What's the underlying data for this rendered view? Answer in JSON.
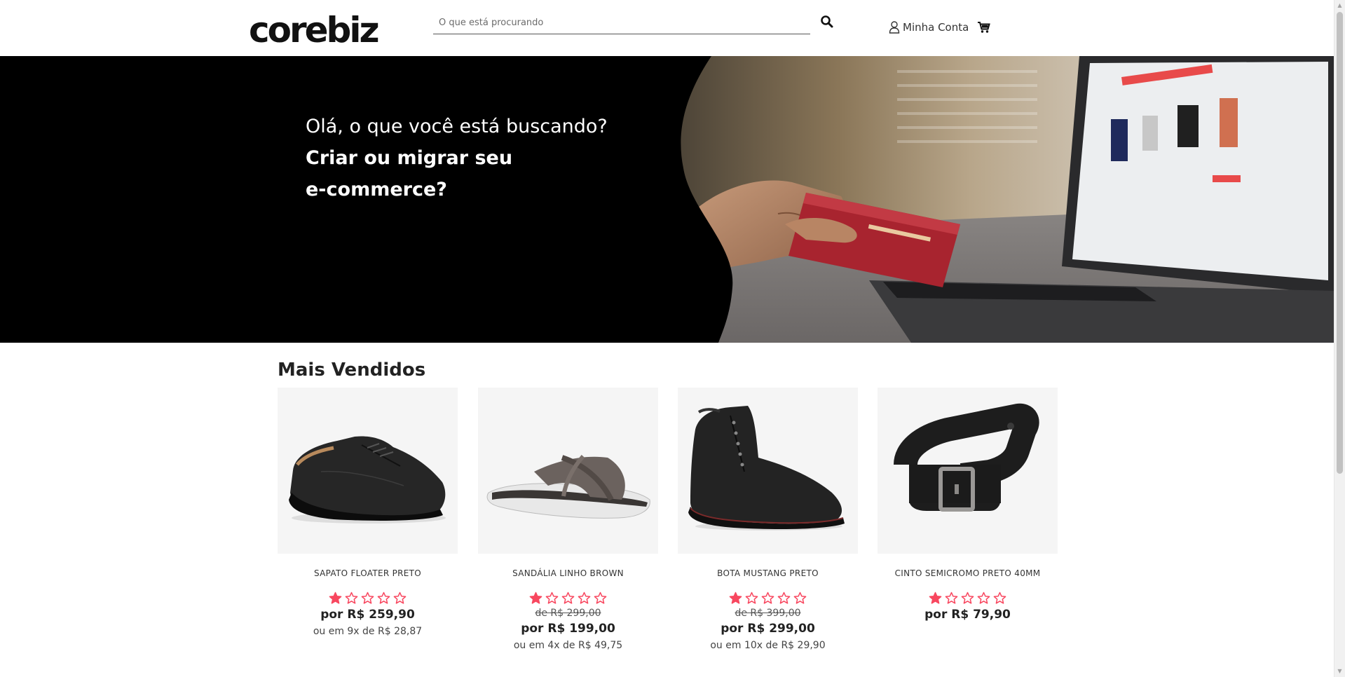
{
  "header": {
    "logo": "corebiz",
    "search_placeholder": "O que está procurando",
    "account_label": "Minha Conta"
  },
  "hero": {
    "line1": "Olá, o que você está buscando?",
    "line2": "Criar ou migrar seu",
    "line3": "e-commerce?"
  },
  "section": {
    "title": "Mais Vendidos"
  },
  "colors": {
    "star": "#f8475f",
    "hero_bg": "#000000",
    "text": "#222222"
  },
  "products": [
    {
      "name": "SAPATO FLOATER PRETO",
      "rating": 1,
      "rating_max": 5,
      "old_price": "",
      "price": "por R$ 259,90",
      "installments": "ou em 9x de R$ 28,87"
    },
    {
      "name": "SANDÁLIA LINHO BROWN",
      "rating": 1,
      "rating_max": 5,
      "old_price": "de R$ 299,00",
      "price": "por R$ 199,00",
      "installments": "ou em 4x de R$ 49,75"
    },
    {
      "name": "BOTA MUSTANG PRETO",
      "rating": 1,
      "rating_max": 5,
      "old_price": "de R$ 399,00",
      "price": "por R$ 299,00",
      "installments": "ou em 10x de R$ 29,90"
    },
    {
      "name": "CINTO SEMICROMO PRETO 40MM",
      "rating": 1,
      "rating_max": 5,
      "old_price": "",
      "price": "por R$ 79,90",
      "installments": ""
    }
  ]
}
